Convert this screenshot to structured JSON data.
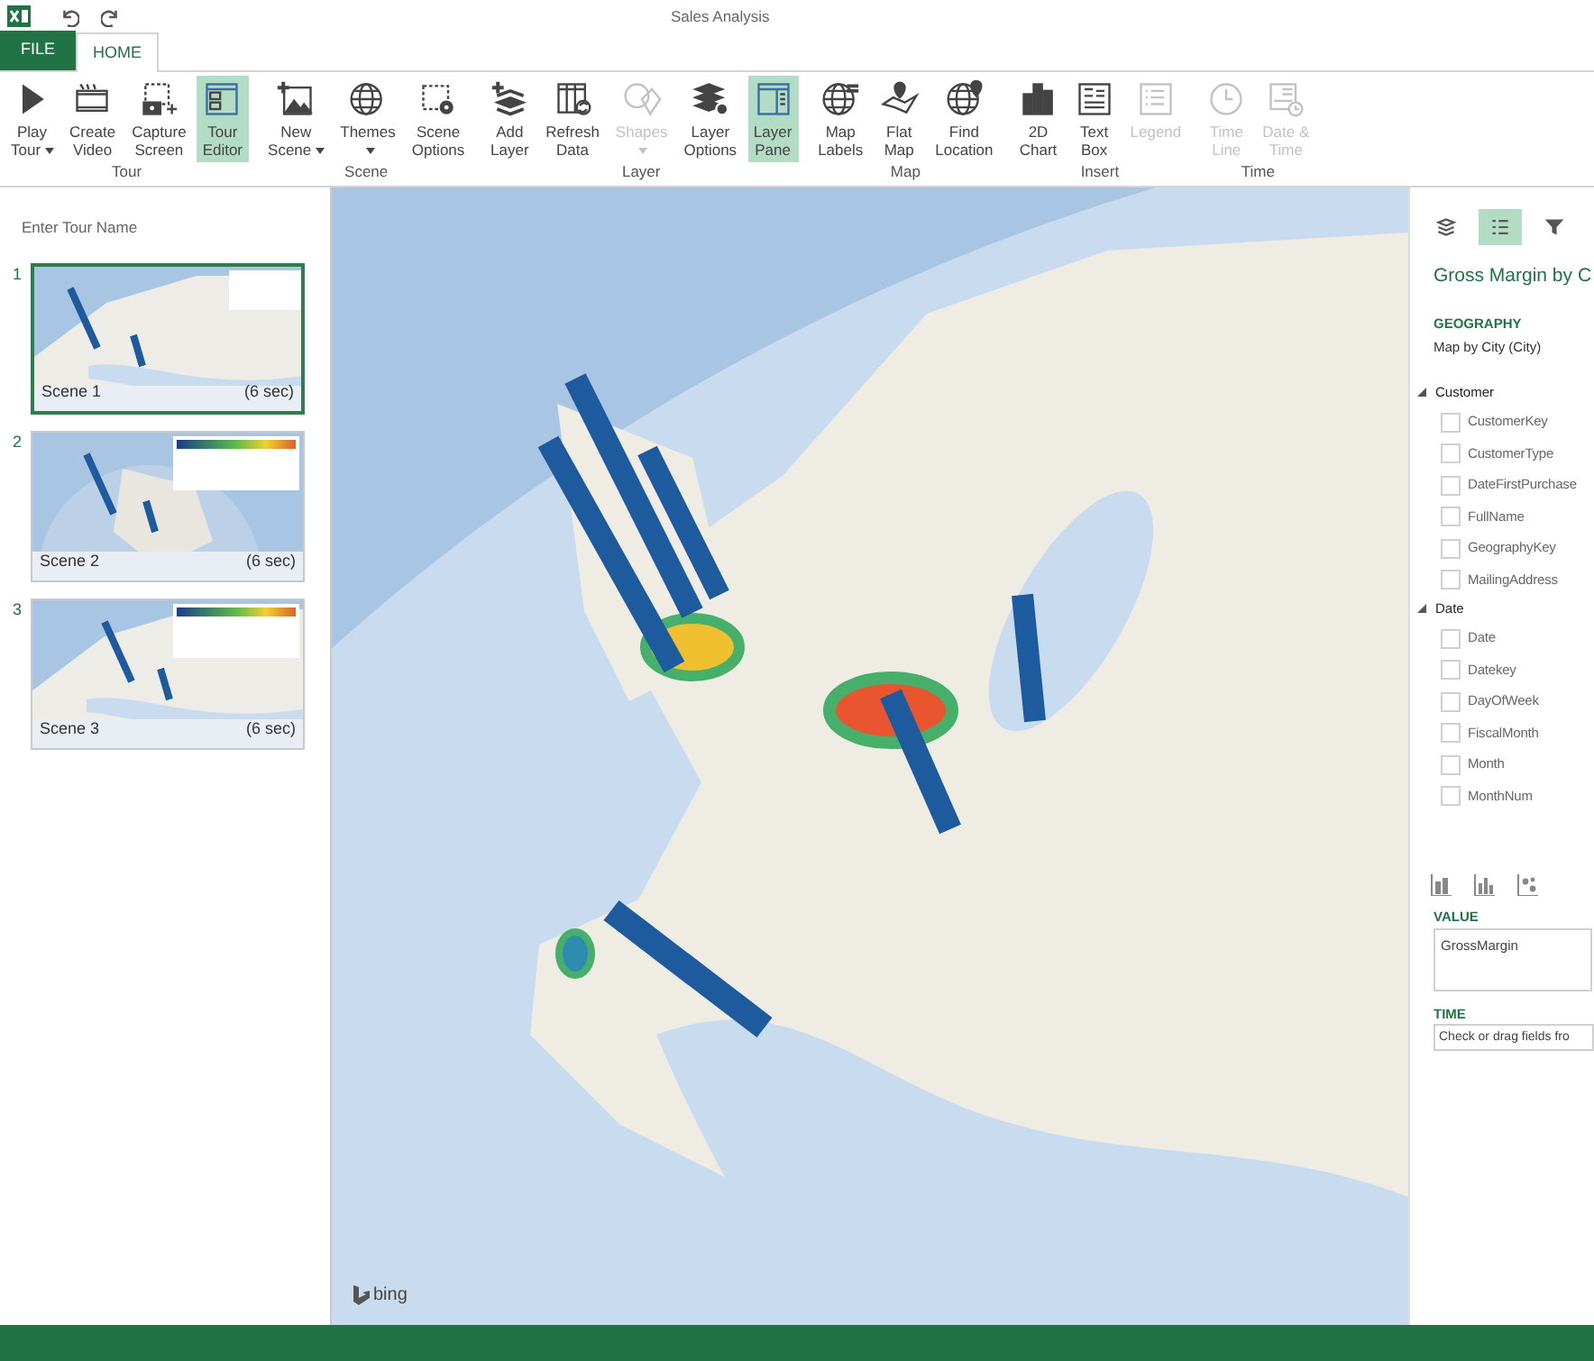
{
  "window": {
    "title": "Sales Analysis"
  },
  "tabs": [
    {
      "label": "FILE",
      "kind": "file",
      "selected": false
    },
    {
      "label": "HOME",
      "kind": "tab",
      "selected": true
    }
  ],
  "ribbon": {
    "groups": [
      {
        "label": "Tour",
        "buttons": [
          {
            "label_lines": [
              "Play",
              "Tour"
            ],
            "dropdown": true,
            "selected": false,
            "disabled": false
          },
          {
            "label_lines": [
              "Create",
              "Video"
            ],
            "dropdown": false,
            "selected": false,
            "disabled": false
          },
          {
            "label_lines": [
              "Capture",
              "Screen"
            ],
            "dropdown": false,
            "selected": false,
            "disabled": false
          },
          {
            "label_lines": [
              "Tour",
              "Editor"
            ],
            "dropdown": false,
            "selected": true,
            "disabled": false
          }
        ]
      },
      {
        "label": "Scene",
        "buttons": [
          {
            "label_lines": [
              "New",
              "Scene"
            ],
            "dropdown": true,
            "selected": false,
            "disabled": false
          },
          {
            "label_lines": [
              "Themes"
            ],
            "dropdown": true,
            "selected": false,
            "disabled": false
          },
          {
            "label_lines": [
              "Scene",
              "Options"
            ],
            "dropdown": false,
            "selected": false,
            "disabled": false
          }
        ]
      },
      {
        "label": "Layer",
        "buttons": [
          {
            "label_lines": [
              "Add",
              "Layer"
            ],
            "dropdown": false,
            "selected": false,
            "disabled": false
          },
          {
            "label_lines": [
              "Refresh",
              "Data"
            ],
            "dropdown": false,
            "selected": false,
            "disabled": false
          },
          {
            "label_lines": [
              "Shapes"
            ],
            "dropdown": true,
            "selected": false,
            "disabled": true
          },
          {
            "label_lines": [
              "Layer",
              "Options"
            ],
            "dropdown": false,
            "selected": false,
            "disabled": false
          },
          {
            "label_lines": [
              "Layer",
              "Pane"
            ],
            "dropdown": false,
            "selected": true,
            "disabled": false
          }
        ]
      },
      {
        "label": "Map",
        "buttons": [
          {
            "label_lines": [
              "Map",
              "Labels"
            ],
            "dropdown": false,
            "selected": false,
            "disabled": false
          },
          {
            "label_lines": [
              "Flat",
              "Map"
            ],
            "dropdown": false,
            "selected": false,
            "disabled": false
          },
          {
            "label_lines": [
              "Find",
              "Location"
            ],
            "dropdown": false,
            "selected": false,
            "disabled": false
          }
        ]
      },
      {
        "label": "Insert",
        "buttons": [
          {
            "label_lines": [
              "2D",
              "Chart"
            ],
            "dropdown": false,
            "selected": false,
            "disabled": false
          },
          {
            "label_lines": [
              "Text",
              "Box"
            ],
            "dropdown": false,
            "selected": false,
            "disabled": false
          },
          {
            "label_lines": [
              "Legend"
            ],
            "dropdown": false,
            "selected": false,
            "disabled": true
          }
        ]
      },
      {
        "label": "Time",
        "buttons": [
          {
            "label_lines": [
              "Time",
              "Line"
            ],
            "dropdown": false,
            "selected": false,
            "disabled": true
          },
          {
            "label_lines": [
              "Date &",
              "Time"
            ],
            "dropdown": false,
            "selected": false,
            "disabled": true
          }
        ]
      }
    ]
  },
  "tour": {
    "name_placeholder": "Enter Tour Name",
    "scenes": [
      {
        "number": "1",
        "name": "Scene 1",
        "duration": "(6 sec)",
        "selected": true
      },
      {
        "number": "2",
        "name": "Scene 2",
        "duration": "(6 sec)",
        "selected": false
      },
      {
        "number": "3",
        "name": "Scene 3",
        "duration": "(6 sec)",
        "selected": false
      }
    ]
  },
  "map": {
    "attribution": "bing"
  },
  "layer_pane": {
    "panel_tabs": [
      {
        "selected": false
      },
      {
        "selected": true
      },
      {
        "selected": false
      }
    ],
    "layer_title": "Gross Margin by C",
    "geography_heading": "GEOGRAPHY",
    "geography_value": "Map by City (City)",
    "fields": [
      {
        "label": "Customer",
        "expanded": true,
        "children": [
          {
            "label": "CustomerKey",
            "checked": false
          },
          {
            "label": "CustomerType",
            "checked": false
          },
          {
            "label": "DateFirstPurchase",
            "checked": false
          },
          {
            "label": "FullName",
            "checked": false
          },
          {
            "label": "GeographyKey",
            "checked": false
          },
          {
            "label": "MailingAddress",
            "checked": false
          }
        ]
      },
      {
        "label": "Date",
        "expanded": true,
        "children": [
          {
            "label": "Date",
            "checked": false
          },
          {
            "label": "Datekey",
            "checked": false
          },
          {
            "label": "DayOfWeek",
            "checked": false
          },
          {
            "label": "FiscalMonth",
            "checked": false
          },
          {
            "label": "Month",
            "checked": false
          },
          {
            "label": "MonthNum",
            "checked": false
          }
        ]
      }
    ],
    "value_heading": "VALUE",
    "value_field": "GrossMargin",
    "time_heading": "TIME",
    "time_placeholder": "Check or drag fields fro"
  }
}
